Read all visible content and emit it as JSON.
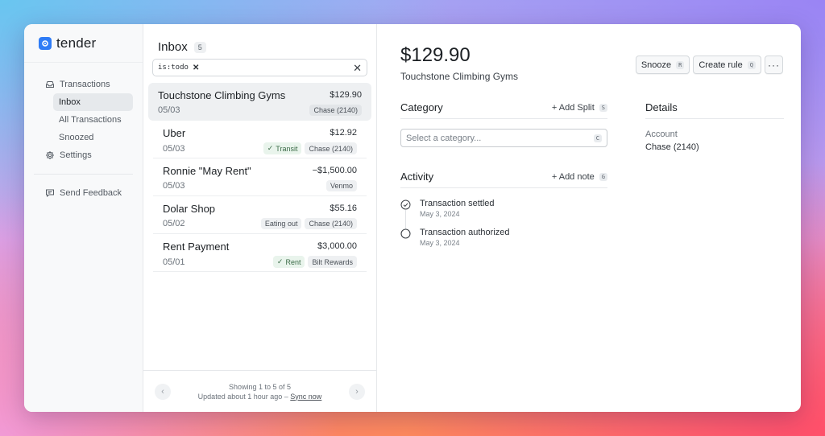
{
  "app": {
    "name": "tender"
  },
  "sidebar": {
    "transactions": "Transactions",
    "sub": [
      "Inbox",
      "All Transactions",
      "Snoozed"
    ],
    "settings": "Settings",
    "feedback": "Send Feedback"
  },
  "list": {
    "title": "Inbox",
    "count": "5",
    "filter_chip": "is:todo",
    "rows": [
      {
        "name": "Touchstone Climbing Gyms",
        "amount": "$129.90",
        "date": "05/03",
        "category": "",
        "account": "Chase (2140)"
      },
      {
        "name": "Uber",
        "amount": "$12.92",
        "date": "05/03",
        "category": "Transit",
        "account": "Chase (2140)"
      },
      {
        "name": "Ronnie \"May Rent\"",
        "amount": "−$1,500.00",
        "date": "05/03",
        "category": "",
        "account": "Venmo"
      },
      {
        "name": "Dolar Shop",
        "amount": "$55.16",
        "date": "05/02",
        "category": "Eating out",
        "account": "Chase (2140)"
      },
      {
        "name": "Rent Payment",
        "amount": "$3,000.00",
        "date": "05/01",
        "category": "Rent",
        "account": "Bilt Rewards"
      }
    ],
    "footer": {
      "showing": "Showing 1 to 5 of 5",
      "updated": "Updated about 1 hour ago –",
      "sync": "Sync now"
    }
  },
  "detail": {
    "amount": "$129.90",
    "merchant": "Touchstone Climbing Gyms",
    "actions": {
      "snooze": "Snooze",
      "snooze_key": "R",
      "create_rule": "Create rule",
      "create_rule_key": "Q",
      "more": "···"
    },
    "category": {
      "title": "Category",
      "add_split": "+ Add Split",
      "add_split_key": "S",
      "placeholder": "Select a category...",
      "select_key": "C"
    },
    "details": {
      "title": "Details",
      "account_label": "Account",
      "account_value": "Chase (2140)"
    },
    "activity": {
      "title": "Activity",
      "add_note": "+ Add note",
      "add_note_key": "G",
      "items": [
        {
          "title": "Transaction settled",
          "date": "May 3, 2024"
        },
        {
          "title": "Transaction authorized",
          "date": "May 3, 2024"
        }
      ]
    }
  },
  "colors": {
    "accent": "#2f7cf6",
    "category_tag": "#e9f4ec"
  }
}
